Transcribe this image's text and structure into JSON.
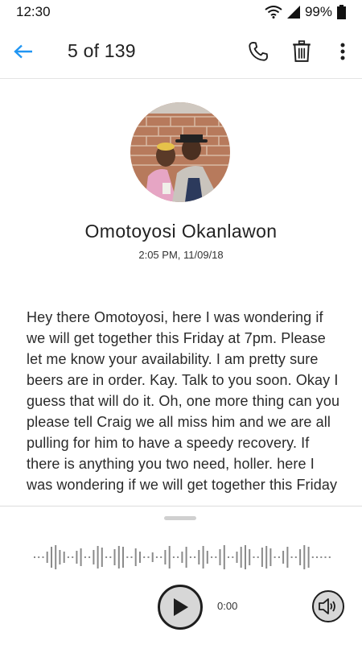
{
  "status_bar": {
    "time": "12:30",
    "battery": "99%",
    "wifi_icon": "wifi-icon",
    "signal_icon": "signal-icon",
    "battery_icon": "battery-icon"
  },
  "header": {
    "title": "5 of 139",
    "back_icon": "arrow-left-icon",
    "call_icon": "phone-icon",
    "delete_icon": "trash-icon",
    "more_icon": "more-vertical-icon",
    "accent_color": "#2196f3"
  },
  "message": {
    "contact_name": "Omotoyosi Okanlawon",
    "timestamp": "2:05 PM, 11/09/18",
    "transcript": "Hey there Omotoyosi, here I was wondering if we will get together this Friday at 7pm. Please let me know your availability.  I am pretty sure beers are in order.  Kay.  Talk to you soon.  Okay I guess that will do it.  Oh, one more thing can you please tell Craig we all miss him and we are all pulling for him to have a speedy recovery.  If there is anything you two need, holler. here I was wondering if we will get together this Friday"
  },
  "player": {
    "elapsed": "0:00",
    "play_icon": "play-icon",
    "speaker_icon": "speaker-icon",
    "progress": 0
  }
}
